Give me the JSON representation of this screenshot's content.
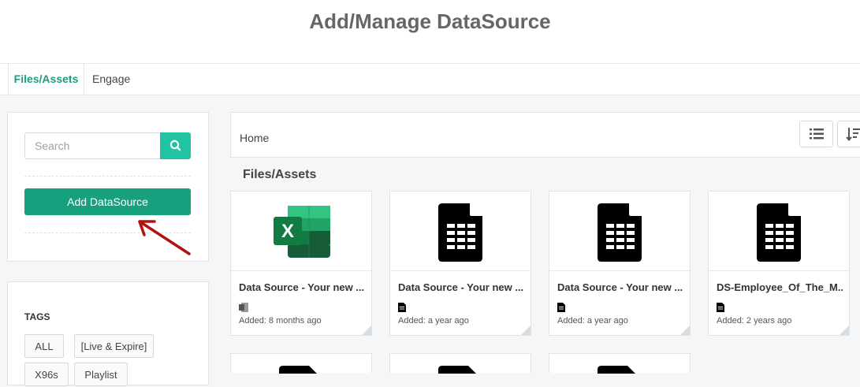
{
  "header": {
    "title": "Add/Manage DataSource"
  },
  "tabs": [
    {
      "label": "Files/Assets",
      "active": true
    },
    {
      "label": "Engage",
      "active": false
    }
  ],
  "sidebar": {
    "search": {
      "placeholder": "Search",
      "value": "",
      "icon": "search-icon"
    },
    "add_button_label": "Add DataSource",
    "tags_title": "TAGS",
    "tags": [
      "ALL",
      "[Live & Expire]",
      "X96s",
      "Playlist"
    ]
  },
  "breadcrumb": {
    "home": "Home"
  },
  "toolbar": {
    "list_view_icon": "list-icon",
    "sort_icon": "sort-icon"
  },
  "section": {
    "title": "Files/Assets"
  },
  "cards": [
    {
      "name": "Data Source - Your new ...",
      "added": "Added: 8 months ago",
      "icon": "excel-icon"
    },
    {
      "name": "Data Source - Your new ...",
      "added": "Added: a year ago",
      "icon": "spreadsheet-file-icon"
    },
    {
      "name": "Data Source - Your new ...",
      "added": "Added: a year ago",
      "icon": "spreadsheet-file-icon"
    },
    {
      "name": "DS-Employee_Of_The_M...",
      "added": "Added: 2 years ago",
      "icon": "spreadsheet-file-icon"
    }
  ],
  "colors": {
    "accent": "#17a07e",
    "search_button": "#22c3a2",
    "tab_active": "#1a9e7e",
    "arrow": "#b01313"
  }
}
